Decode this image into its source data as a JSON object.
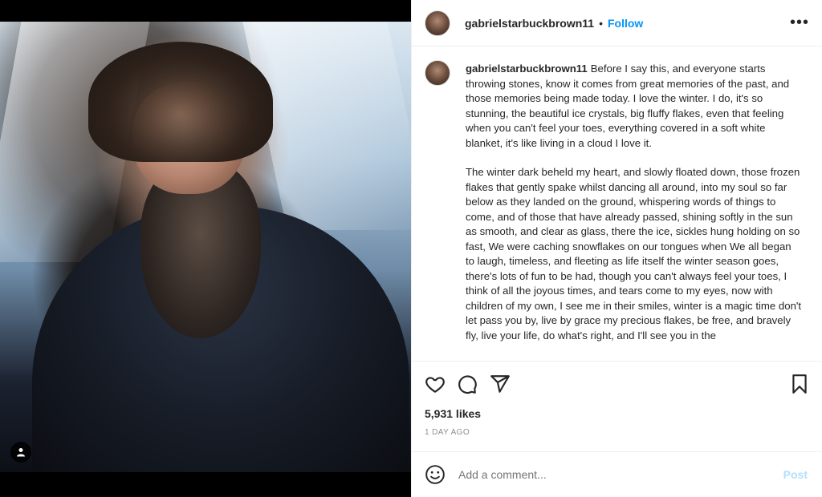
{
  "post": {
    "username": "gabrielstarbuckbrown11",
    "separator": "•",
    "follow_label": "Follow",
    "more_icon": "more-horizontal-icon",
    "caption_paragraphs": [
      "Before I say this, and everyone starts throwing stones, know it comes from great memories of the past, and those memories being made today. I love the winter. I do, it's so stunning, the beautiful ice crystals, big fluffy flakes, even that feeling when you can't feel your toes, everything covered in a soft white blanket, it's like living in a cloud I love it.",
      "The winter dark beheld my heart, and slowly floated down, those frozen flakes that gently spake whilst dancing all around, into my soul so far below as they landed on the ground, whispering words of things to come, and of those that have already passed, shining softly in the sun as smooth, and clear as glass, there the ice, sickles hung holding on so fast, We were caching snowflakes on our tongues when We all began to laugh, timeless, and fleeting as life itself the winter season goes, there's lots of fun to be had, though you can't always feel your toes, I think of all the joyous times, and tears come to my eyes, now with children of my own, I see me in their smiles, winter is a magic time don't let pass you by, live by grace my precious flakes, be free, and bravely fly, live your life, do what's right, and I'll see you in the"
    ],
    "likes": "5,931 likes",
    "timestamp": "1 DAY AGO"
  },
  "comment": {
    "placeholder": "Add a comment...",
    "post_label": "Post"
  },
  "icons": {
    "like": "heart-icon",
    "comment": "comment-icon",
    "share": "paper-plane-icon",
    "save": "bookmark-icon",
    "emoji": "smiley-icon",
    "user_tag": "person-icon"
  },
  "colors": {
    "accent": "#0095f6",
    "post_disabled": "#b2dffc",
    "text": "#262626",
    "muted": "#8e8e8e"
  }
}
